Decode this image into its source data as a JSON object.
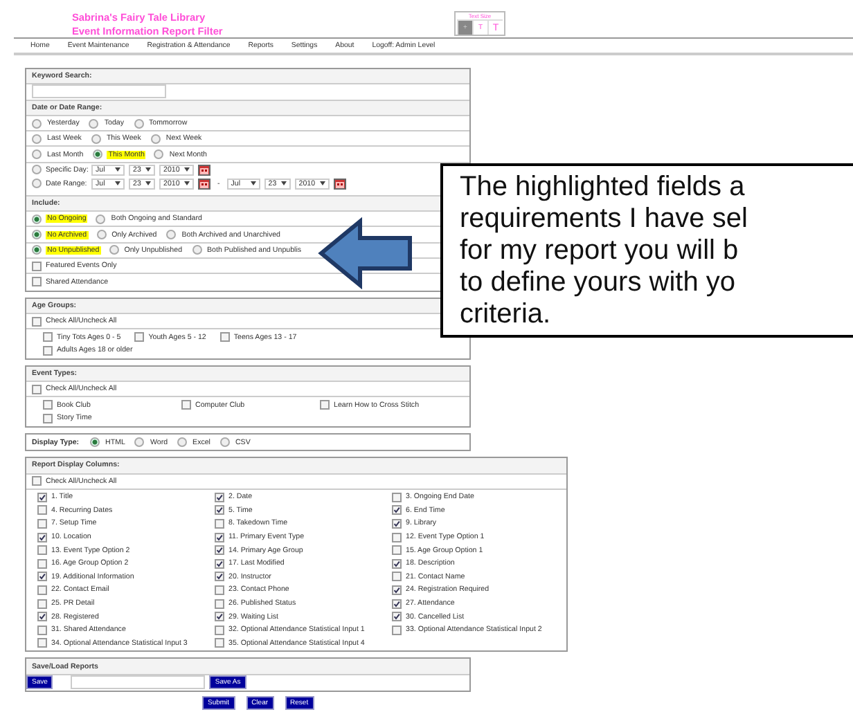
{
  "header": {
    "title": [
      "Sabrina's Fairy Tale Library",
      "Event Information Report Filter"
    ],
    "text_size": {
      "label": "Text Size",
      "options": [
        {
          "label": "+",
          "selected": true
        },
        {
          "label": "T",
          "selected": false
        },
        {
          "label": "T",
          "selected": false
        }
      ]
    }
  },
  "nav": [
    "Home",
    "Event Maintenance",
    "Registration & Attendance",
    "Reports",
    "Settings",
    "About",
    "Logoff: Admin Level"
  ],
  "boxes": [
    {
      "wide": false,
      "rows": [
        {
          "kind": "header",
          "label": "Keyword Search:"
        },
        {
          "kind": "input"
        },
        {
          "kind": "header",
          "label": "Date or Date Range:"
        },
        {
          "kind": "radios",
          "options": [
            {
              "label": "Yesterday",
              "selected": false,
              "highlighted": false
            },
            {
              "label": "Today",
              "selected": false,
              "highlighted": false
            },
            {
              "label": "Tommorrow",
              "selected": false,
              "highlighted": false
            }
          ]
        },
        {
          "kind": "radios",
          "options": [
            {
              "label": "Last Week",
              "selected": false,
              "highlighted": false
            },
            {
              "label": "This Week",
              "selected": false,
              "highlighted": false
            },
            {
              "label": "Next Week",
              "selected": false,
              "highlighted": false
            }
          ]
        },
        {
          "kind": "radios",
          "options": [
            {
              "label": "Last Month",
              "selected": false,
              "highlighted": false
            },
            {
              "label": "This Month",
              "selected": true,
              "highlighted": true
            },
            {
              "label": "Next Month",
              "selected": false,
              "highlighted": false
            }
          ]
        },
        {
          "kind": "dates",
          "lines": [
            {
              "label": "Specific Day:",
              "selected": false,
              "dates": [
                [
                  "Jul",
                  "23",
                  "2010"
                ]
              ]
            },
            {
              "label": "Date Range:",
              "selected": false,
              "separator": "-",
              "dates": [
                [
                  "Jul",
                  "23",
                  "2010"
                ],
                [
                  "Jul",
                  "23",
                  "2010"
                ]
              ]
            }
          ]
        },
        {
          "kind": "header",
          "label": "Include:"
        },
        {
          "kind": "radios",
          "options": [
            {
              "label": "No Ongoing",
              "selected": true,
              "highlighted": true
            },
            {
              "label": "Both Ongoing and Standard",
              "selected": false,
              "highlighted": false
            }
          ]
        },
        {
          "kind": "radios",
          "options": [
            {
              "label": "No Archived",
              "selected": true,
              "highlighted": true
            },
            {
              "label": "Only Archived",
              "selected": false,
              "highlighted": false
            },
            {
              "label": "Both Archived and Unarchived",
              "selected": false,
              "highlighted": false
            }
          ]
        },
        {
          "kind": "radios",
          "options": [
            {
              "label": "No Unpublished",
              "selected": true,
              "highlighted": true
            },
            {
              "label": "Only Unpublished",
              "selected": false,
              "highlighted": false
            },
            {
              "label": "Both Published and Unpublis",
              "selected": false,
              "highlighted": false
            }
          ]
        },
        {
          "kind": "check",
          "label": "Featured Events Only",
          "checked": false
        },
        {
          "kind": "check",
          "label": "Shared Attendance",
          "checked": false
        }
      ]
    },
    {
      "wide": false,
      "rows": [
        {
          "kind": "header",
          "label": "Age Groups:"
        },
        {
          "kind": "check",
          "label": "Check All/Uncheck All",
          "checked": false
        },
        {
          "kind": "flow-checks",
          "items": [
            {
              "label": "Tiny Tots Ages 0 - 5",
              "checked": false
            },
            {
              "label": "Youth Ages 5 - 12",
              "checked": false
            },
            {
              "label": "Teens Ages 13 - 17",
              "checked": false
            },
            {
              "label": "Adults Ages 18 or older",
              "checked": false
            }
          ]
        }
      ]
    },
    {
      "wide": false,
      "rows": [
        {
          "kind": "header",
          "label": "Event Types:"
        },
        {
          "kind": "check",
          "label": "Check All/Uncheck All",
          "checked": false
        },
        {
          "kind": "grid-checks",
          "items": [
            {
              "label": "Book Club",
              "checked": false
            },
            {
              "label": "Computer Club",
              "checked": false
            },
            {
              "label": "Learn How to Cross Stitch",
              "checked": false
            },
            {
              "label": "Story Time",
              "checked": false
            }
          ]
        }
      ]
    },
    {
      "wide": false,
      "rows": [
        {
          "kind": "radios",
          "label": "Display Type:",
          "options": [
            {
              "label": "HTML",
              "selected": true,
              "highlighted": false
            },
            {
              "label": "Word",
              "selected": false,
              "highlighted": false
            },
            {
              "label": "Excel",
              "selected": false,
              "highlighted": false
            },
            {
              "label": "CSV",
              "selected": false,
              "highlighted": false
            }
          ]
        }
      ]
    },
    {
      "wide": true,
      "rows": [
        {
          "kind": "header",
          "label": "Report Display Columns:"
        },
        {
          "kind": "check",
          "label": "Check All/Uncheck All",
          "checked": false
        },
        {
          "kind": "grid-checks",
          "items": [
            {
              "label": "1. Title",
              "checked": true
            },
            {
              "label": "2. Date",
              "checked": true
            },
            {
              "label": "3. Ongoing End Date",
              "checked": false
            },
            {
              "label": "4. Recurring Dates",
              "checked": false
            },
            {
              "label": "5. Time",
              "checked": true
            },
            {
              "label": "6. End Time",
              "checked": true
            },
            {
              "label": "7. Setup Time",
              "checked": false
            },
            {
              "label": "8. Takedown Time",
              "checked": false
            },
            {
              "label": "9. Library",
              "checked": true
            },
            {
              "label": "10. Location",
              "checked": true
            },
            {
              "label": "11. Primary Event Type",
              "checked": true
            },
            {
              "label": "12. Event Type Option 1",
              "checked": false
            },
            {
              "label": "13. Event Type Option 2",
              "checked": false
            },
            {
              "label": "14. Primary Age Group",
              "checked": true
            },
            {
              "label": "15. Age Group Option 1",
              "checked": false
            },
            {
              "label": "16. Age Group Option 2",
              "checked": false
            },
            {
              "label": "17. Last Modified",
              "checked": true
            },
            {
              "label": "18. Description",
              "checked": true
            },
            {
              "label": "19. Additional Information",
              "checked": true
            },
            {
              "label": "20. Instructor",
              "checked": true
            },
            {
              "label": "21. Contact Name",
              "checked": false
            },
            {
              "label": "22. Contact Email",
              "checked": false
            },
            {
              "label": "23. Contact Phone",
              "checked": false
            },
            {
              "label": "24. Registration Required",
              "checked": true
            },
            {
              "label": "25. PR Detail",
              "checked": false
            },
            {
              "label": "26. Published Status",
              "checked": false
            },
            {
              "label": "27. Attendance",
              "checked": true
            },
            {
              "label": "28. Registered",
              "checked": true
            },
            {
              "label": "29. Waiting List",
              "checked": true
            },
            {
              "label": "30. Cancelled List",
              "checked": true
            },
            {
              "label": "31. Shared Attendance",
              "checked": false
            },
            {
              "label": "32. Optional Attendance Statistical Input 1",
              "checked": false
            },
            {
              "label": "33. Optional Attendance Statistical Input 2",
              "checked": false
            },
            {
              "label": "34. Optional Attendance Statistical Input 3",
              "checked": false
            },
            {
              "label": "35. Optional Attendance Statistical Input 4",
              "checked": false
            }
          ]
        }
      ]
    },
    {
      "wide": false,
      "rows": [
        {
          "kind": "header",
          "label": "Save/Load Reports"
        },
        {
          "kind": "save",
          "buttons": [
            "Save",
            "Save As"
          ]
        }
      ]
    }
  ],
  "actions": [
    "Submit",
    "Clear",
    "Reset"
  ],
  "callout": {
    "lines": [
      "The highlighted fields a",
      "requirements I have sel",
      "for my report you will b",
      "to define yours with yo",
      "criteria."
    ]
  }
}
